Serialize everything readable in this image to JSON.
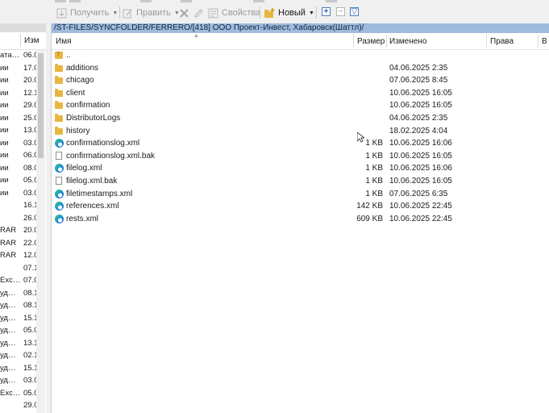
{
  "toolbar": {
    "get_label": "Получить",
    "edit_label": "Править",
    "props_label": "Свойства",
    "new_label": "Новый",
    "plus_glyph": "+",
    "minus_glyph": "−",
    "filter_glyph": "▽"
  },
  "left_panel": {
    "col_header": "Изм",
    "rows": [
      {
        "c1": "ата…",
        "c2": "06.0"
      },
      {
        "c1": "ии",
        "c2": "17.0"
      },
      {
        "c1": "ии",
        "c2": "20.0"
      },
      {
        "c1": "ии",
        "c2": "12.1"
      },
      {
        "c1": "ии",
        "c2": "29.0"
      },
      {
        "c1": "ии",
        "c2": "25.0"
      },
      {
        "c1": "ии",
        "c2": "13.0"
      },
      {
        "c1": "ии",
        "c2": "03.0"
      },
      {
        "c1": "ии",
        "c2": "06.0"
      },
      {
        "c1": "ии",
        "c2": "08.0"
      },
      {
        "c1": "ии",
        "c2": "05.0"
      },
      {
        "c1": "ии",
        "c2": "03.0"
      },
      {
        "c1": "",
        "c2": "16.1"
      },
      {
        "c1": "",
        "c2": "26.0"
      },
      {
        "c1": "RAR",
        "c2": "20.0"
      },
      {
        "c1": "RAR",
        "c2": "22.0"
      },
      {
        "c1": "RAR",
        "c2": "12.0"
      },
      {
        "c1": "",
        "c2": "07.1"
      },
      {
        "c1": "Exc…",
        "c2": "07.0"
      },
      {
        "c1": "уд…",
        "c2": "08.1"
      },
      {
        "c1": "уд…",
        "c2": "08.1"
      },
      {
        "c1": "уд…",
        "c2": "15.1"
      },
      {
        "c1": "уд…",
        "c2": "05.0"
      },
      {
        "c1": "уд…",
        "c2": "13.1"
      },
      {
        "c1": "уд…",
        "c2": "02.1"
      },
      {
        "c1": "уд…",
        "c2": "15.1"
      },
      {
        "c1": "уд…",
        "c2": "03.0"
      },
      {
        "c1": "Exc…",
        "c2": "05.0"
      },
      {
        "c1": "",
        "c2": "29.0"
      }
    ]
  },
  "right_panel": {
    "path": "/ST-FILES/SYNCFOLDER/FERRERO/[418] ООО Проект-Инвест, Хабаровск(Шаттл)/",
    "columns": {
      "name": "Имя",
      "size": "Размер",
      "modified": "Изменено",
      "rights": "Права",
      "owner": "В"
    },
    "files": [
      {
        "name": "..",
        "size": "",
        "modified": "",
        "icon": "parent-folder-icon"
      },
      {
        "name": "additions",
        "size": "",
        "modified": "04.06.2025 2:35",
        "icon": "folder-icon"
      },
      {
        "name": "chicago",
        "size": "",
        "modified": "07.06.2025 8:45",
        "icon": "folder-icon"
      },
      {
        "name": "client",
        "size": "",
        "modified": "10.06.2025 16:05",
        "icon": "folder-icon"
      },
      {
        "name": "confirmation",
        "size": "",
        "modified": "10.06.2025 16:05",
        "icon": "folder-icon"
      },
      {
        "name": "DistributorLogs",
        "size": "",
        "modified": "04.06.2025 2:35",
        "icon": "folder-icon"
      },
      {
        "name": "history",
        "size": "",
        "modified": "18.02.2025 4:04",
        "icon": "folder-icon"
      },
      {
        "name": "confirmationslog.xml",
        "size": "1 KB",
        "modified": "10.06.2025 16:06",
        "icon": "edge-icon"
      },
      {
        "name": "confirmationslog.xml.bak",
        "size": "1 KB",
        "modified": "10.06.2025 16:05",
        "icon": "document-icon"
      },
      {
        "name": "filelog.xml",
        "size": "1 KB",
        "modified": "10.06.2025 16:06",
        "icon": "edge-icon"
      },
      {
        "name": "filelog.xml.bak",
        "size": "1 KB",
        "modified": "10.06.2025 16:05",
        "icon": "document-icon"
      },
      {
        "name": "filetimestamps.xml",
        "size": "1 KB",
        "modified": "07.06.2025 6:35",
        "icon": "edge-icon"
      },
      {
        "name": "references.xml",
        "size": "142 KB",
        "modified": "10.06.2025 22:45",
        "icon": "edge-icon"
      },
      {
        "name": "rests.xml",
        "size": "609 KB",
        "modified": "10.06.2025 22:45",
        "icon": "edge-icon"
      }
    ]
  }
}
